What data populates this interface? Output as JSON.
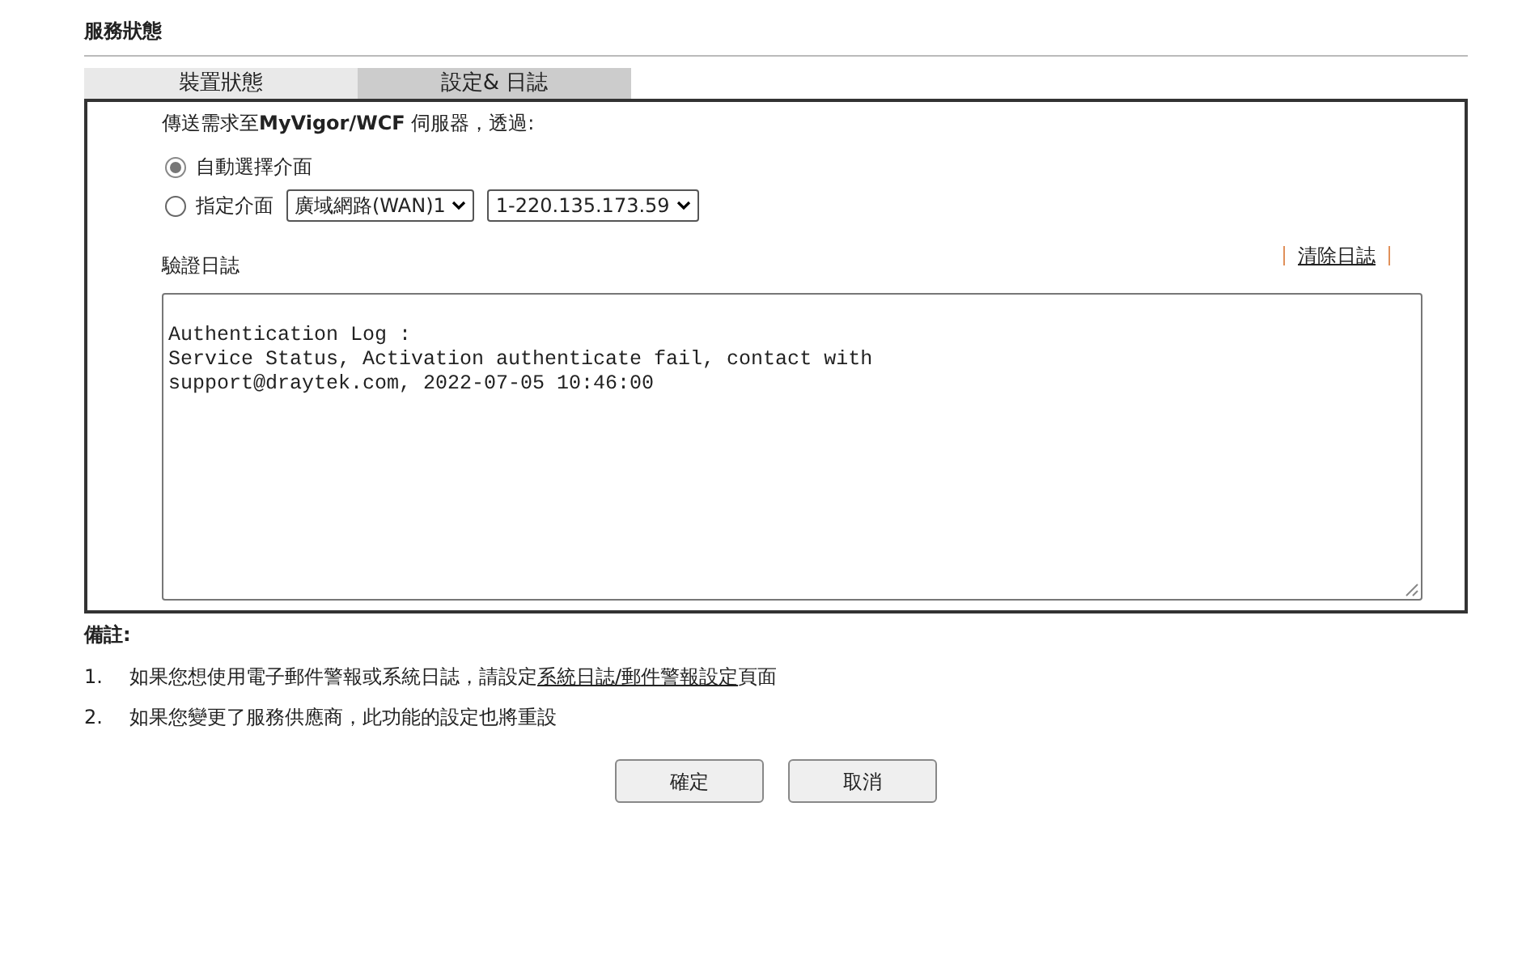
{
  "page_title": "服務狀態",
  "tabs": [
    {
      "label": "裝置狀態",
      "selected": false
    },
    {
      "label": "設定& 日誌",
      "selected": true
    }
  ],
  "request": {
    "label": "傳送需求至**MyVigor/WCF** 伺服器，透過:",
    "options": [
      {
        "label": "自動選擇介面",
        "selected": true
      },
      {
        "label": "指定介面",
        "selected": false,
        "dropdowns": [
          "廣域網路(WAN)1",
          "1-220.135.173.59"
        ]
      }
    ]
  },
  "log": {
    "label": "驗證日誌",
    "clear_link": "清除日誌",
    "lines": [
      "Authentication Log :",
      "Service Status, Activation authenticate fail, contact with",
      "support@draytek.com, 2022-07-05 10:46:00"
    ]
  },
  "notes": {
    "title": "備註:",
    "items": [
      {
        "number": "1.",
        "text": "如果您想使用電子郵件警報或系統日誌，請設定",
        "link": "系統日誌/郵件警報設定",
        "after": "頁面"
      },
      {
        "number": "2.",
        "text": "如果您變更了服務供應商，此功能的設定也將重設"
      }
    ]
  },
  "buttons": [
    "確定",
    "取消"
  ]
}
